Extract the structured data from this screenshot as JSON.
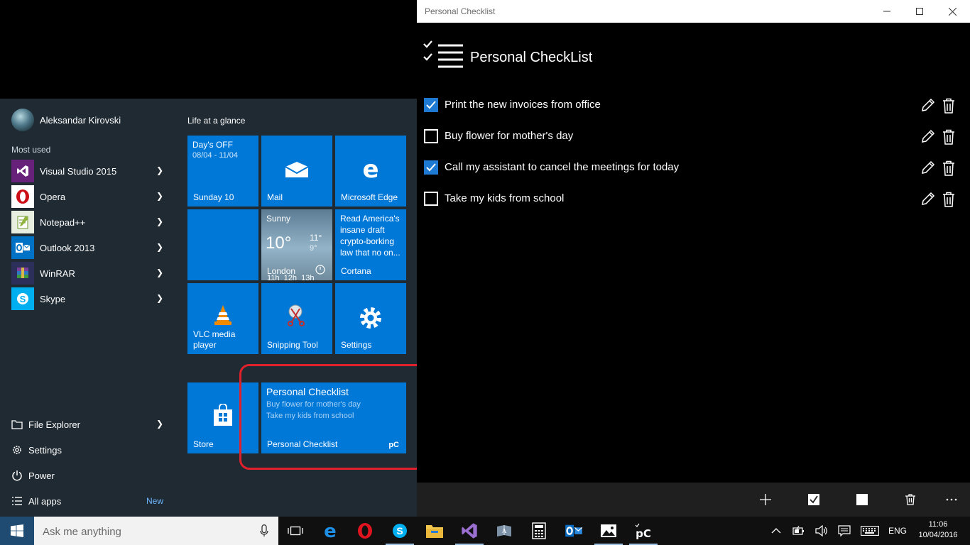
{
  "start_menu": {
    "user": {
      "name": "Aleksandar Kirovski"
    },
    "most_used_label": "Most used",
    "apps": [
      {
        "label": "Visual Studio 2015",
        "icon": "visual-studio-icon",
        "color": "#68217a"
      },
      {
        "label": "Opera",
        "icon": "opera-icon",
        "color": "#cc0f16"
      },
      {
        "label": "Notepad++",
        "icon": "notepadpp-icon",
        "color": "#90b43c"
      },
      {
        "label": "Outlook 2013",
        "icon": "outlook-icon",
        "color": "#0072c6"
      },
      {
        "label": "WinRAR",
        "icon": "winrar-icon",
        "color": "#7b3f99"
      },
      {
        "label": "Skype",
        "icon": "skype-icon",
        "color": "#00aff0"
      }
    ],
    "bottom": {
      "file_explorer": "File Explorer",
      "settings": "Settings",
      "power": "Power",
      "all_apps": "All apps",
      "new_badge": "New"
    },
    "tiles_group": "Life at a glance",
    "tiles": {
      "calendar": {
        "title": "Day's OFF",
        "dates": "08/04 - 11/04",
        "day": "Sunday 10"
      },
      "mail": {
        "label": "Mail"
      },
      "edge": {
        "label": "Microsoft Edge"
      },
      "weather": {
        "condition": "Sunny",
        "temp": "10°",
        "high": "11°",
        "low": "9°",
        "location": "London",
        "hours": "11h  12h  13h"
      },
      "cortana": {
        "headline": "Read America's insane draft crypto-borking law that no on...",
        "label": "Cortana"
      },
      "vlc": {
        "label": "VLC media player"
      },
      "snipping": {
        "label": "Snipping Tool"
      },
      "settings": {
        "label": "Settings"
      },
      "store": {
        "label": "Store"
      },
      "checklist": {
        "title": "Personal Checklist",
        "line1": "Buy flower for mother's day",
        "line2": "Take my kids from school",
        "label": "Personal Checklist",
        "badge": "pC"
      }
    }
  },
  "app_window": {
    "window_title": "Personal Checklist",
    "app_title": "Personal CheckList",
    "tasks": [
      {
        "text": "Print the new invoices from office",
        "checked": true
      },
      {
        "text": "Buy flower for mother's day",
        "checked": false
      },
      {
        "text": "Call my assistant to cancel the meetings for today",
        "checked": true
      },
      {
        "text": "Take my kids from school",
        "checked": false
      }
    ],
    "accent_color": "#1e79d3"
  },
  "taskbar": {
    "search_placeholder": "Ask me anything",
    "apps": [
      "task-view-icon",
      "edge-icon",
      "opera-icon",
      "skype-icon",
      "file-explorer-icon",
      "visual-studio-icon",
      "dictionary-icon",
      "calculator-icon",
      "outlook-icon",
      "photos-icon",
      "personal-checklist-icon"
    ],
    "language": "ENG",
    "time": "11:06",
    "date": "10/04/2016",
    "start_color": "#1f4b73"
  }
}
